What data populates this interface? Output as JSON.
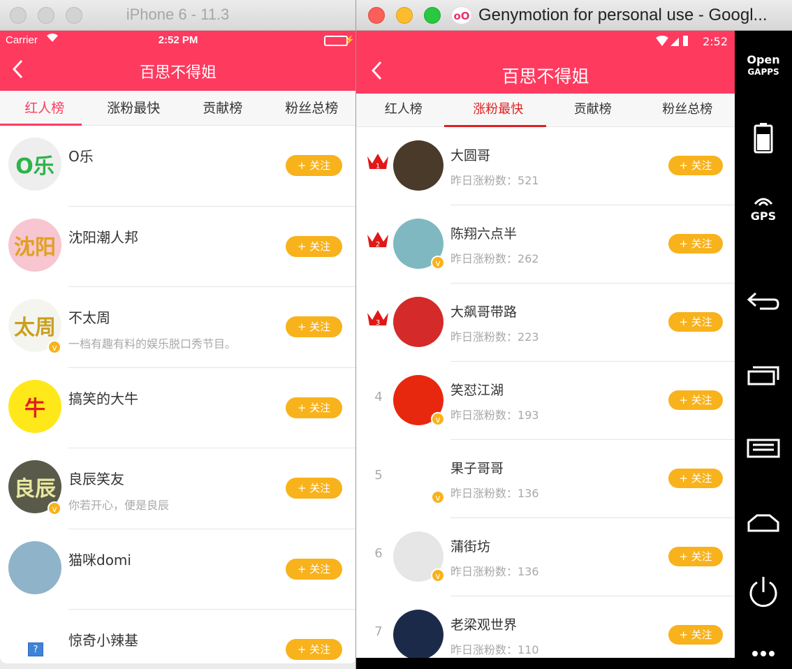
{
  "ios": {
    "window_title": "iPhone 6 - 11.3",
    "status": {
      "carrier": "Carrier",
      "time": "2:52 PM"
    },
    "nav_title": "百思不得姐",
    "tabs": [
      "红人榜",
      "涨粉最快",
      "贡献榜",
      "粉丝总榜"
    ],
    "active_tab": 0,
    "items": [
      {
        "name": "O乐",
        "desc": "",
        "avatar_text": "O乐",
        "avatar_bg": "#eeeeee",
        "avatar_color": "#2db34a",
        "verified": false
      },
      {
        "name": "沈阳潮人邦",
        "desc": "",
        "avatar_text": "沈阳",
        "avatar_bg": "#f7c6d0",
        "avatar_color": "#e0a020",
        "verified": false
      },
      {
        "name": "不太周",
        "desc": "一档有趣有料的娱乐脱口秀节目。",
        "avatar_text": "太周",
        "avatar_bg": "#f5f5f0",
        "avatar_color": "#c9a020",
        "verified": true
      },
      {
        "name": "搞笑的大牛",
        "desc": "",
        "avatar_text": "牛",
        "avatar_bg": "#ffe81a",
        "avatar_color": "#e02020",
        "verified": false
      },
      {
        "name": "良辰笑友",
        "desc": "你若开心，便是良辰",
        "avatar_text": "良辰",
        "avatar_bg": "#5a5a4a",
        "avatar_color": "#e8e8a0",
        "verified": true
      },
      {
        "name": "猫咪domi",
        "desc": "",
        "avatar_text": "",
        "avatar_bg": "#8fb3c8",
        "avatar_color": "#ffffff",
        "verified": false
      },
      {
        "name": "惊奇小辣基",
        "desc": "",
        "avatar_text": "",
        "avatar_bg": "#ffffff",
        "avatar_color": "#ffffff",
        "verified": false
      }
    ],
    "follow_label": "+ 关注",
    "help_label": "?"
  },
  "geny": {
    "window_title": "Genymotion for personal use - Googl...",
    "logo_text": "oO",
    "status": {
      "time": "2:52"
    },
    "nav_title": "百思不得姐",
    "tabs": [
      "红人榜",
      "涨粉最快",
      "贡献榜",
      "粉丝总榜"
    ],
    "active_tab": 1,
    "sub_prefix": "昨日涨粉数：",
    "items": [
      {
        "rank": "1",
        "name": "大圆哥",
        "count": "521",
        "avatar_bg": "#4a3a2a",
        "avatar_text": "",
        "verified": false
      },
      {
        "rank": "2",
        "name": "陈翔六点半",
        "count": "262",
        "avatar_bg": "#7fb8c0",
        "avatar_text": "",
        "verified": true
      },
      {
        "rank": "3",
        "name": "大飙哥带路",
        "count": "223",
        "avatar_bg": "#d42a2a",
        "avatar_text": "",
        "verified": false
      },
      {
        "rank": "4",
        "name": "笑怼江湖",
        "count": "193",
        "avatar_bg": "#e8280e",
        "avatar_text": "",
        "verified": true
      },
      {
        "rank": "5",
        "name": "果子哥哥",
        "count": "136",
        "avatar_bg": "#ffffff",
        "avatar_text": "",
        "verified": true
      },
      {
        "rank": "6",
        "name": "蒲街坊",
        "count": "136",
        "avatar_bg": "#e6e6e6",
        "avatar_text": "",
        "verified": true
      },
      {
        "rank": "7",
        "name": "老梁观世界",
        "count": "110",
        "avatar_bg": "#1c2a4a",
        "avatar_text": "",
        "verified": false
      }
    ],
    "follow_label": "+ 关注",
    "side": {
      "open": "Open",
      "gapps": "GAPPS",
      "gps": "GPS"
    }
  },
  "colors": {
    "brand": "#ff3a5f",
    "follow": "#f8b21b",
    "tab_active_android": "#e02020",
    "crown": "#e01818"
  }
}
